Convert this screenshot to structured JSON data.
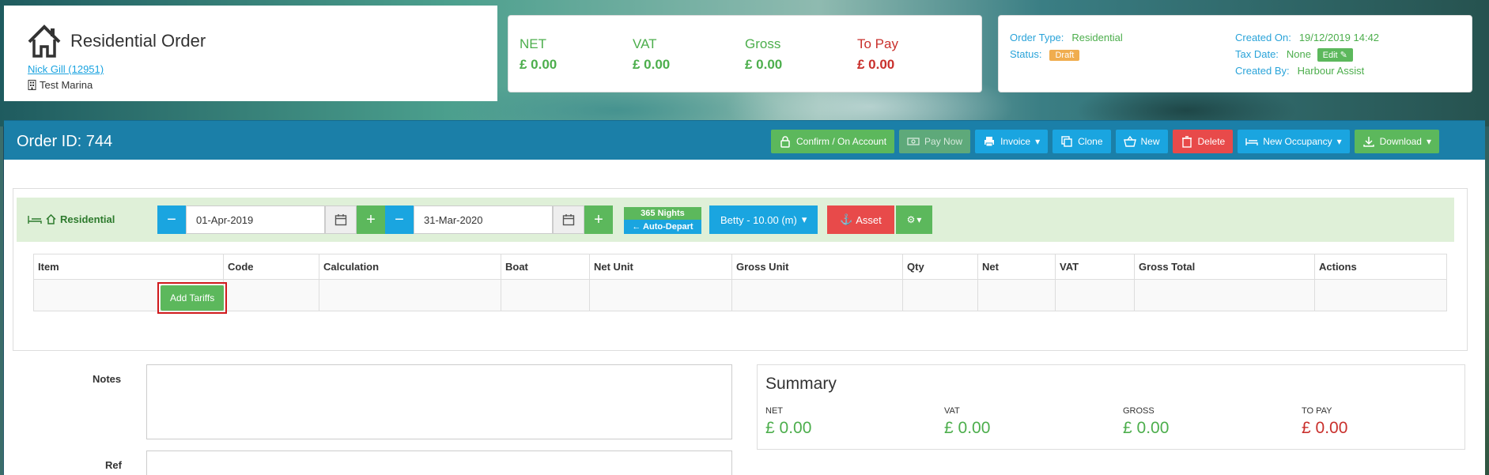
{
  "header": {
    "title": "Residential Order",
    "customer_link": "Nick Gill (12951)",
    "marina": "Test Marina"
  },
  "totals": {
    "net_label": "NET",
    "net_value": "£ 0.00",
    "vat_label": "VAT",
    "vat_value": "£ 0.00",
    "gross_label": "Gross",
    "gross_value": "£ 0.00",
    "topay_label": "To Pay",
    "topay_value": "£ 0.00"
  },
  "meta": {
    "order_type_label": "Order Type:",
    "order_type_value": "Residential",
    "status_label": "Status:",
    "status_value": "Draft",
    "created_on_label": "Created On:",
    "created_on_value": "19/12/2019 14:42",
    "tax_date_label": "Tax Date:",
    "tax_date_value": "None",
    "edit_label": "Edit",
    "created_by_label": "Created By:",
    "created_by_value": "Harbour Assist"
  },
  "order_bar": {
    "order_id": "Order ID: 744",
    "buttons": {
      "confirm": "Confirm / On Account",
      "pay_now": "Pay Now",
      "invoice": "Invoice",
      "clone": "Clone",
      "new": "New",
      "delete": "Delete",
      "new_occupancy": "New Occupancy",
      "download": "Download"
    }
  },
  "residential": {
    "label": "Residential",
    "start_date": "01-Apr-2019",
    "end_date": "31-Mar-2020",
    "nights": "365 Nights",
    "auto_depart": "Auto-Depart",
    "boat": "Betty - 10.00 (m)",
    "asset": "Asset"
  },
  "table": {
    "columns": [
      "Item",
      "Code",
      "Calculation",
      "Boat",
      "Net Unit",
      "Gross Unit",
      "Qty",
      "Net",
      "VAT",
      "Gross Total",
      "Actions"
    ],
    "add_tariffs": "Add Tariffs"
  },
  "form": {
    "notes_label": "Notes",
    "ref_label": "Ref"
  },
  "summary": {
    "title": "Summary",
    "net_label": "NET",
    "net_value": "£ 0.00",
    "vat_label": "VAT",
    "vat_value": "£ 0.00",
    "gross_label": "GROSS",
    "gross_value": "£ 0.00",
    "topay_label": "TO PAY",
    "topay_value": "£ 0.00"
  },
  "colors": {
    "green": "#4cae4c",
    "red": "#c9302c",
    "blue": "#1aa5e0",
    "order_bar": "#1b7fa8",
    "draft_badge": "#f0ad4e"
  }
}
